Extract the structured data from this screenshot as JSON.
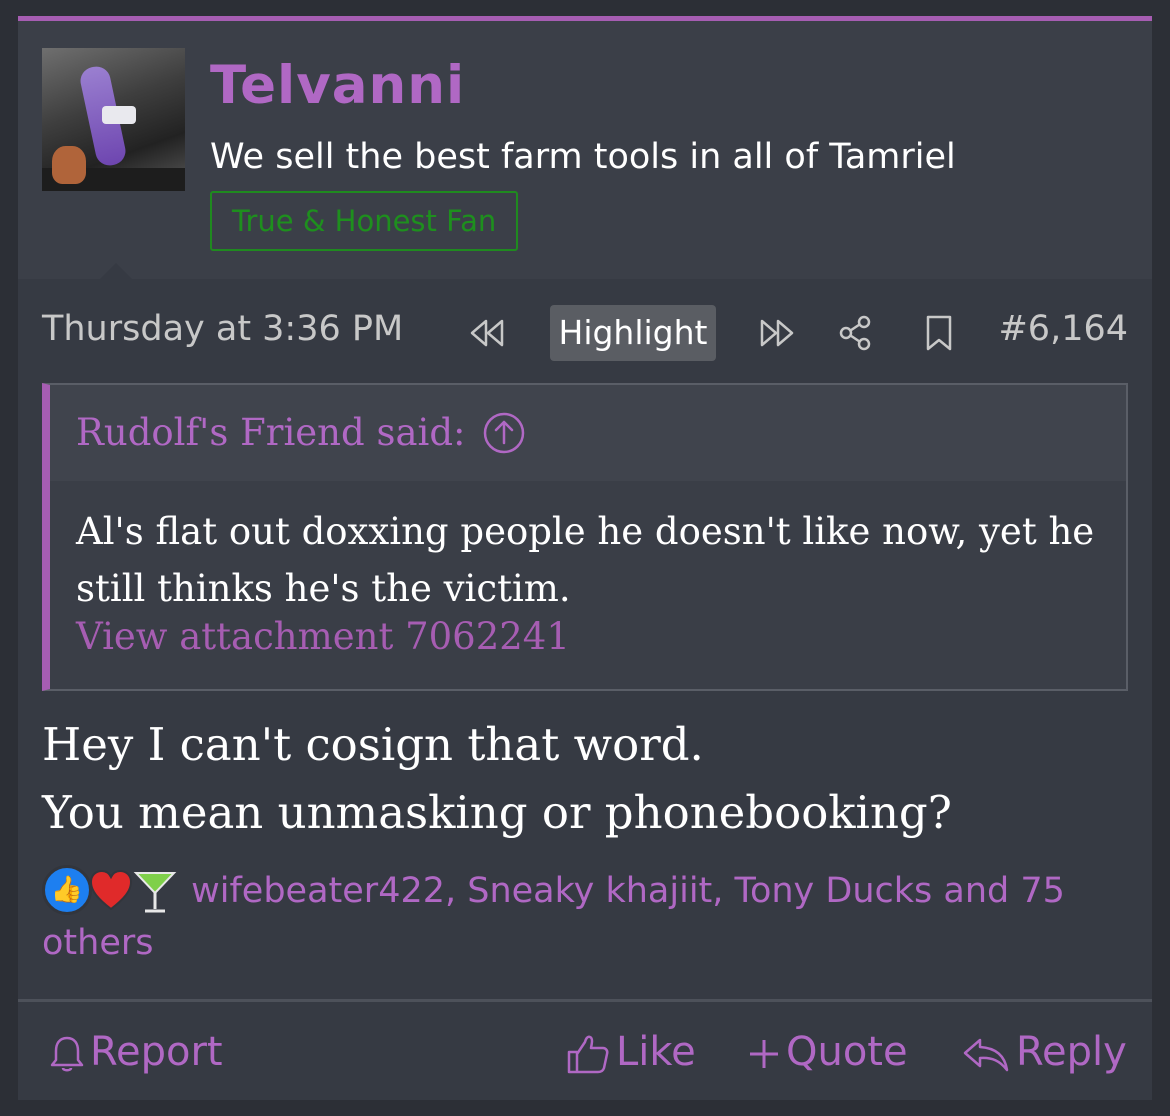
{
  "user": {
    "name": "Telvanni",
    "title": "We sell the best farm tools in all of Tamriel",
    "banner": "True & Honest Fan"
  },
  "meta": {
    "date": "Thursday at 3:36 PM",
    "highlight_label": "Highlight",
    "post_number": "#6,164"
  },
  "quote": {
    "attribution": "Rudolf's Friend said:",
    "body": "Al's flat out doxxing people he doesn't like now, yet he still thinks he's the victim.",
    "attachment": "View attachment 7062241"
  },
  "message": {
    "line1": "Hey I can't cosign that word.",
    "line2": "You mean unmasking or phonebooking?"
  },
  "reactions": {
    "icons": [
      "like-icon",
      "heart-icon",
      "cocktail-icon"
    ],
    "text": "wifebeater422, Sneaky khajiit, Tony Ducks and 75 others"
  },
  "actions": {
    "report": "Report",
    "like": "Like",
    "quote": "Quote",
    "reply": "Reply"
  },
  "colors": {
    "accent": "#a65db2",
    "background": "#363a43",
    "banner_green": "#1e8f1e"
  }
}
